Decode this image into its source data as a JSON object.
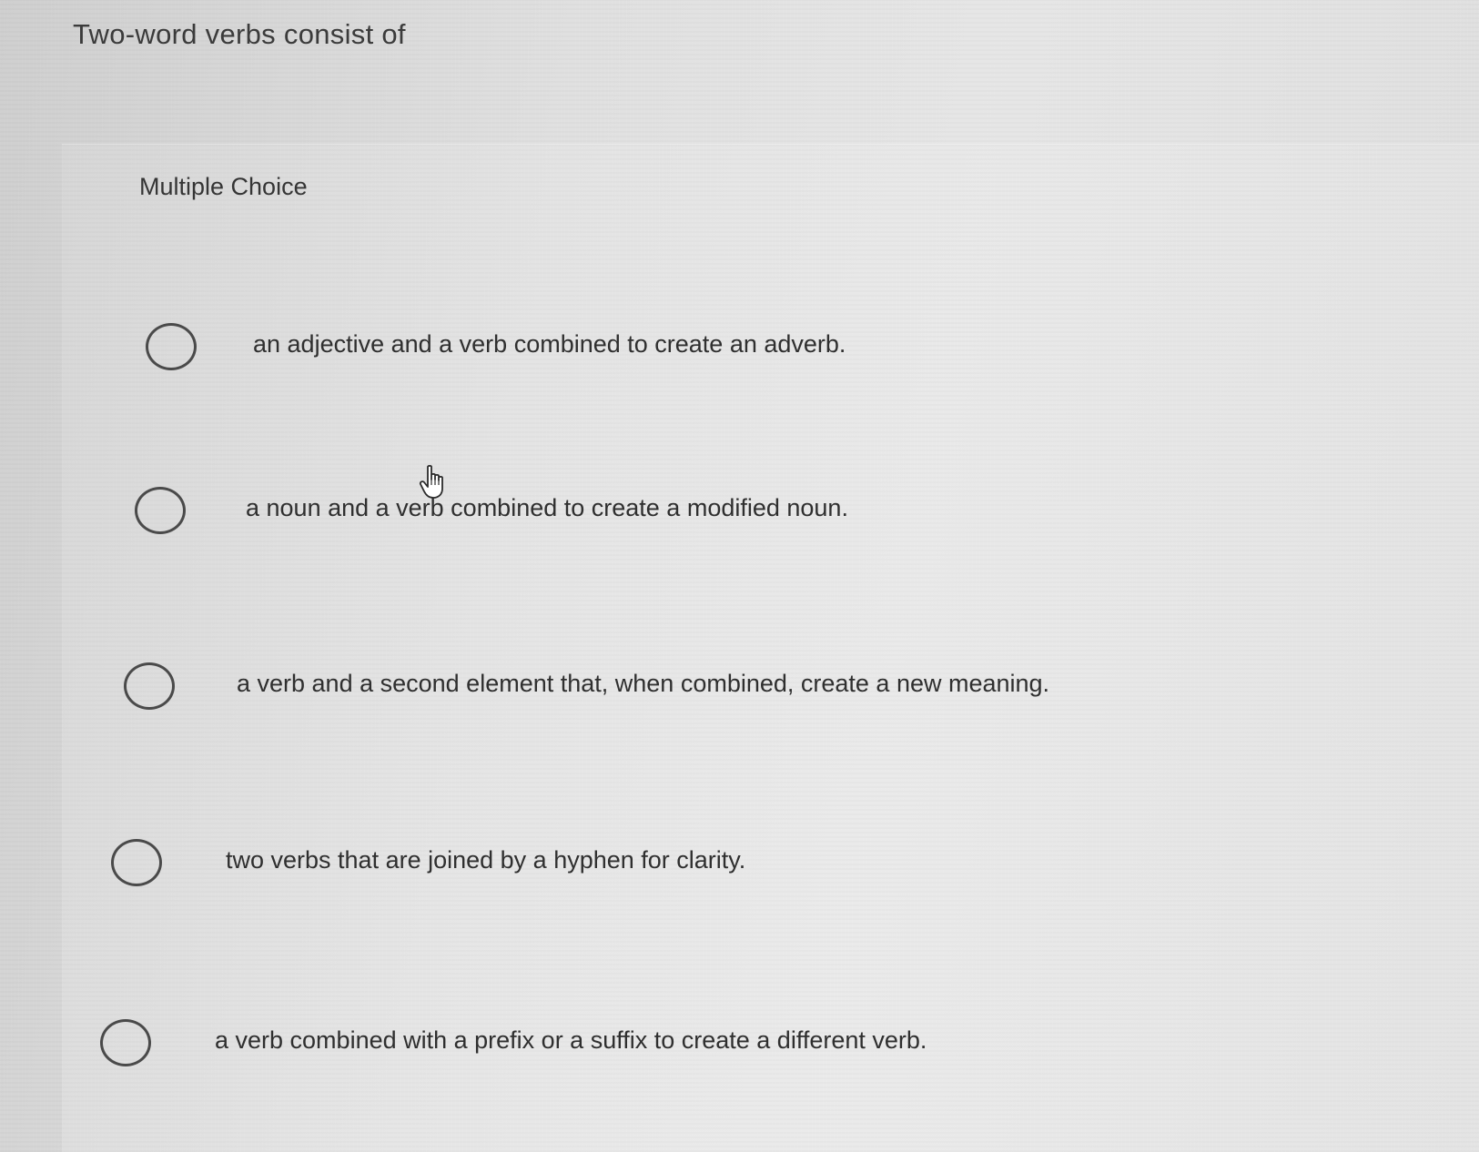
{
  "question": {
    "text": "Two-word verbs consist of"
  },
  "question_type": "Multiple Choice",
  "options": [
    {
      "label": "an adjective and a verb combined to create an adverb.",
      "selected": false
    },
    {
      "label": "a noun and a verb combined to create a modified noun.",
      "selected": false
    },
    {
      "label": "a verb and a second element that, when combined, create a new meaning.",
      "selected": false
    },
    {
      "label": "two verbs that are joined by a hyphen for clarity.",
      "selected": false
    },
    {
      "label": "a verb combined with a prefix or a suffix to create a different verb.",
      "selected": false
    }
  ],
  "cursor": "hand-pointer-icon"
}
